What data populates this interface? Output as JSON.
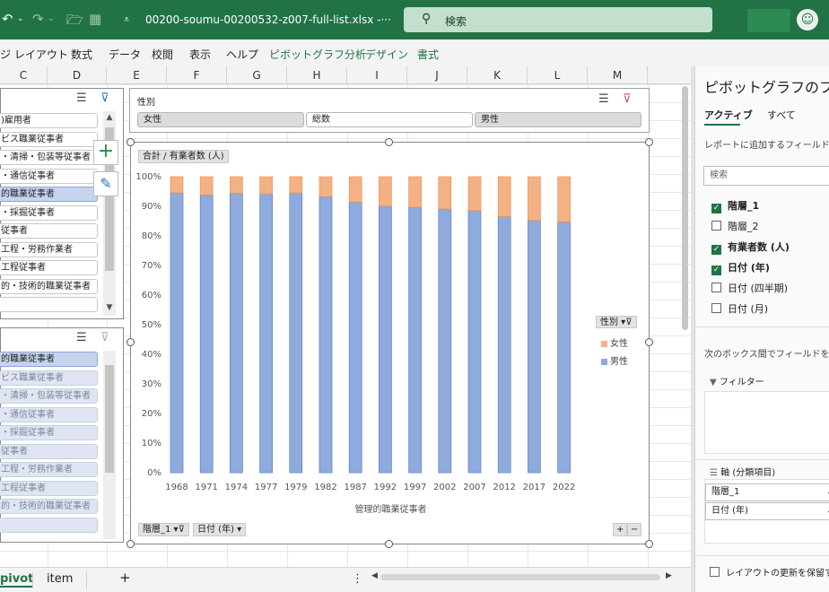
{
  "titlebar": {
    "filename": "00200-soumu-00200532-z007-full-list.xlsx  -···",
    "search_placeholder": "検索",
    "undo_icon": "undo-icon",
    "redo_icon": "redo-icon",
    "open_icon": "folder-icon",
    "user_icon": "user-icon"
  },
  "ribbon": {
    "tabs": [
      "ジ レイアウト",
      "数式",
      "データ",
      "校閲",
      "表示",
      "ヘルプ",
      "ピボットグラフ分析",
      "デザイン",
      "書式"
    ]
  },
  "columns": [
    "C",
    "D",
    "E",
    "F",
    "G",
    "H",
    "I",
    "J",
    "K",
    "L",
    "M"
  ],
  "slicer1": {
    "items": [
      ")雇用者",
      "ビス職業従事者",
      "・清掃・包装等従事者",
      "・通信従事者",
      "的職業従事者",
      "・採掘従事者",
      "従事者",
      "工程・労務作業者",
      "工程従事者",
      "的・技術的職業従事者",
      ""
    ],
    "selected_index": 4
  },
  "slicer2": {
    "items": [
      "的職業従事者",
      "ビス職業従事者",
      "・清掃・包装等従事者",
      "・通信従事者",
      "・採掘従事者",
      "従事者",
      "工程・労務作業者",
      "工程従事者",
      "的・技術的職業従事者",
      ""
    ],
    "selected_index": 0
  },
  "sex_slicer": {
    "title": "性別",
    "buttons": [
      "女性",
      "総数",
      "男性"
    ],
    "selected": [
      true,
      false,
      true
    ]
  },
  "chart_fields": {
    "value_field": "合計 / 有業者数 (人)",
    "axis_field_1": "階層_1",
    "axis_field_2": "日付 (年)"
  },
  "chart_data": {
    "type": "bar",
    "stacked": "percent",
    "categories": [
      "1968",
      "1971",
      "1974",
      "1977",
      "1979",
      "1982",
      "1987",
      "1992",
      "1997",
      "2002",
      "2007",
      "2012",
      "2017",
      "2022"
    ],
    "series": [
      {
        "name": "男性",
        "color": "#8faadc",
        "values": [
          94.6,
          93.8,
          94.4,
          94.2,
          94.5,
          93.2,
          91.4,
          90.1,
          89.7,
          89.1,
          88.6,
          86.5,
          85.2,
          84.7
        ]
      },
      {
        "name": "女性",
        "color": "#f4b183",
        "values": [
          5.4,
          6.2,
          5.6,
          5.8,
          5.5,
          6.8,
          8.6,
          9.9,
          10.3,
          10.9,
          11.4,
          13.5,
          14.8,
          15.3
        ]
      }
    ],
    "xlabel": "管理的職業従事者",
    "ylabel": "",
    "ylim": [
      0,
      100
    ],
    "yticks": [
      "0%",
      "10%",
      "20%",
      "30%",
      "40%",
      "50%",
      "60%",
      "70%",
      "80%",
      "90%",
      "100%"
    ],
    "legend_title": "性別",
    "legend_position": "right",
    "legend_entries": [
      "女性",
      "男性"
    ],
    "grid": false
  },
  "sheettabs": {
    "tabs": [
      "pivot",
      "item"
    ],
    "add": "+",
    "more": "⋮"
  },
  "pane": {
    "title": "ピボットグラフのフィ",
    "tab_active": "アクティブ",
    "tab_all": "すべて",
    "hint": "レポートに追加するフィールドを選",
    "search_placeholder": "検索",
    "fields": [
      {
        "label": "階層_1",
        "checked": true
      },
      {
        "label": "階層_2",
        "checked": false
      },
      {
        "label": "有業者数 (人)",
        "checked": true
      },
      {
        "label": "日付 (年)",
        "checked": true
      },
      {
        "label": "日付 (四半期)",
        "checked": false
      },
      {
        "label": "日付 (月)",
        "checked": false
      }
    ],
    "drag_hint": "次のボックス間でフィールドをドラ",
    "filter_label": "フィルター",
    "axis_label": "軸 (分類項目)",
    "axis_items": [
      "階層_1",
      "日付 (年)"
    ],
    "defer_label": "レイアウトの更新を保留す"
  }
}
